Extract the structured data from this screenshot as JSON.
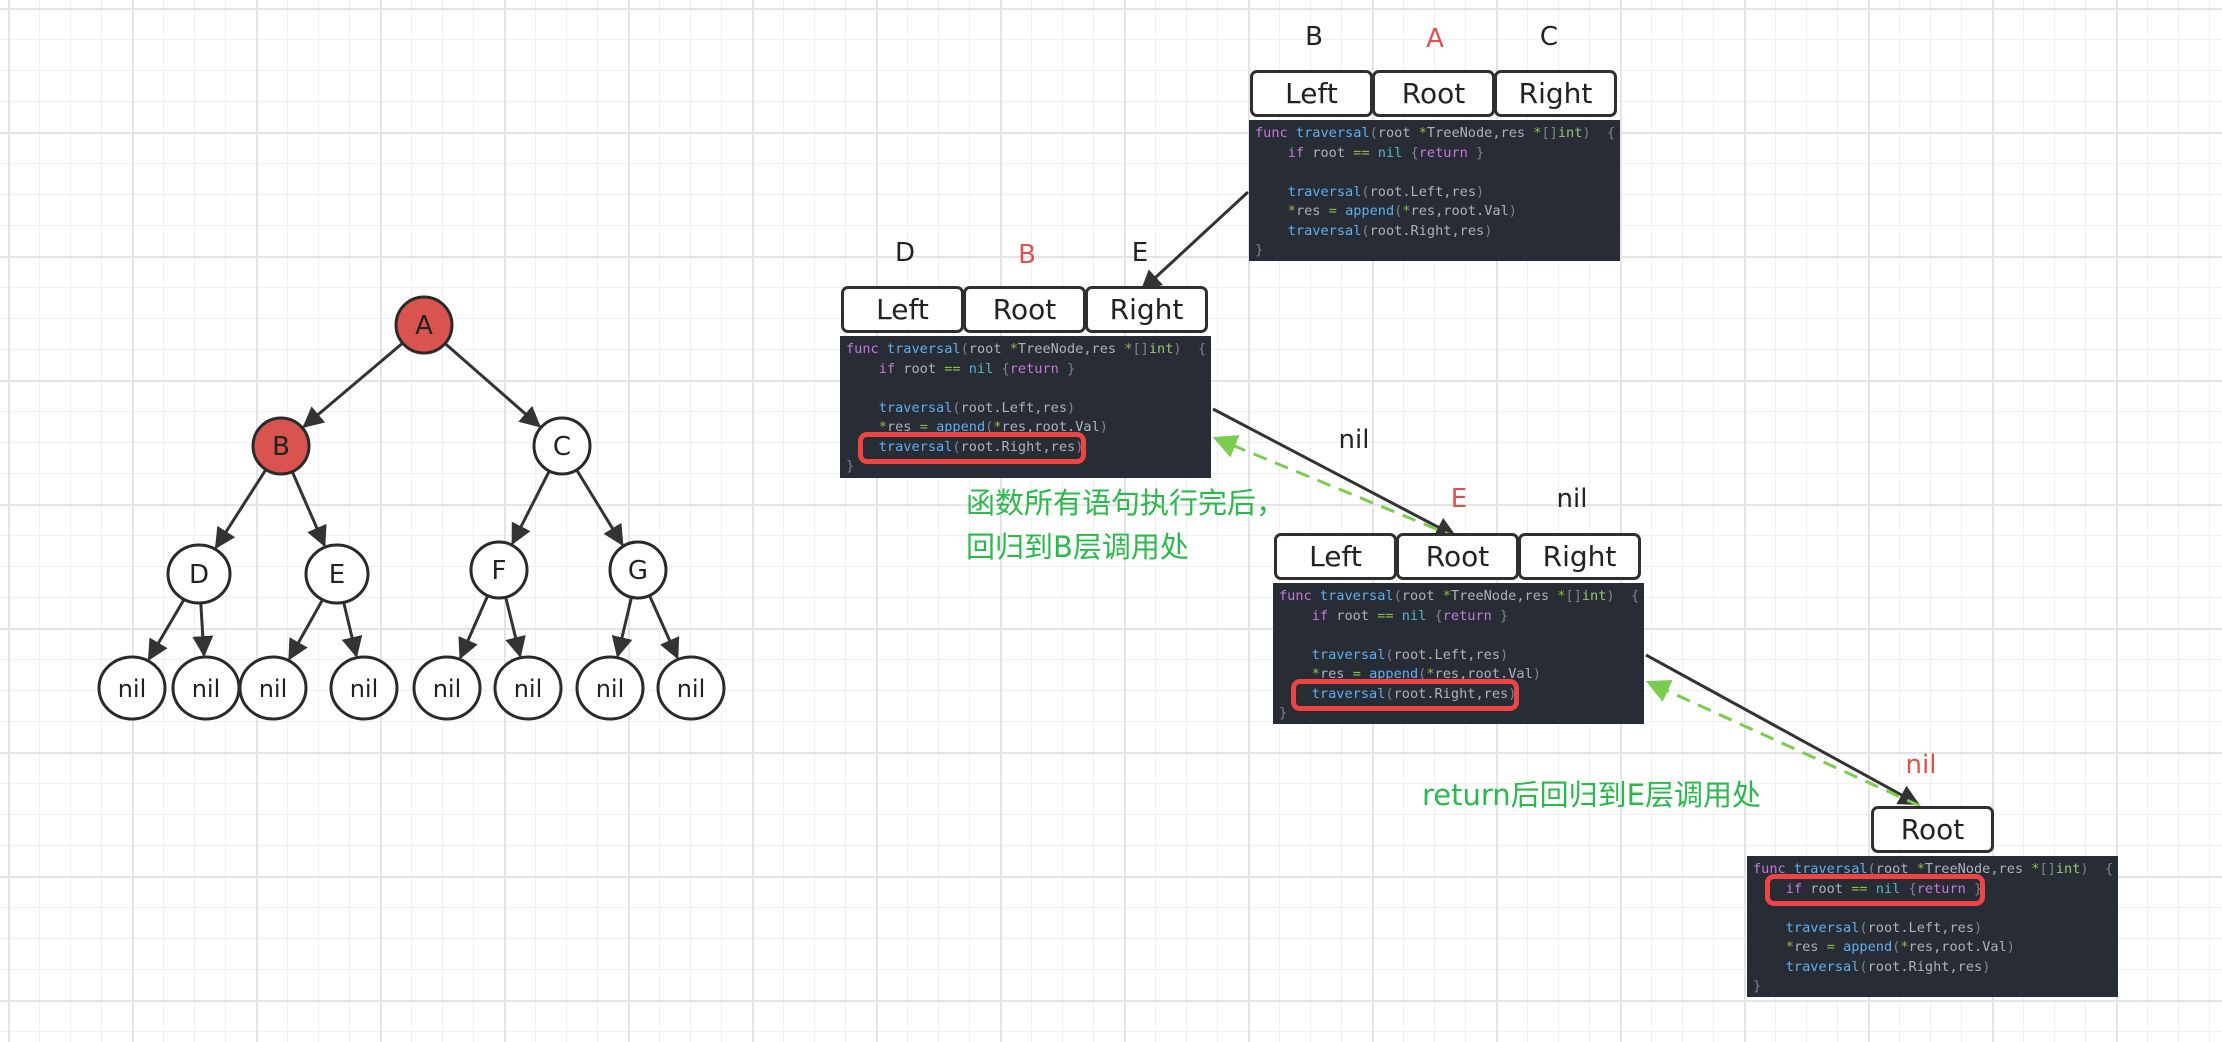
{
  "colors": {
    "highlight_node": "#d9534f",
    "normal_node": "#ffffff",
    "edge": "#333333",
    "return_arrow": "#7ccc52",
    "note_text": "#2db84d",
    "label_active": "#d9534f",
    "code_bg": "#282c34",
    "highlight_box": "#ef4444"
  },
  "tree": {
    "nodes": [
      {
        "id": "A",
        "label": "A",
        "highlighted": true
      },
      {
        "id": "B",
        "label": "B",
        "highlighted": true
      },
      {
        "id": "C",
        "label": "C",
        "highlighted": false
      },
      {
        "id": "D",
        "label": "D",
        "highlighted": false
      },
      {
        "id": "E",
        "label": "E",
        "highlighted": false
      },
      {
        "id": "F",
        "label": "F",
        "highlighted": false
      },
      {
        "id": "G",
        "label": "G",
        "highlighted": false
      },
      {
        "id": "n1",
        "label": "nil",
        "highlighted": false
      },
      {
        "id": "n2",
        "label": "nil",
        "highlighted": false
      },
      {
        "id": "n3",
        "label": "nil",
        "highlighted": false
      },
      {
        "id": "n4",
        "label": "nil",
        "highlighted": false
      },
      {
        "id": "n5",
        "label": "nil",
        "highlighted": false
      },
      {
        "id": "n6",
        "label": "nil",
        "highlighted": false
      },
      {
        "id": "n7",
        "label": "nil",
        "highlighted": false
      },
      {
        "id": "n8",
        "label": "nil",
        "highlighted": false
      }
    ],
    "edges": [
      [
        "A",
        "B"
      ],
      [
        "A",
        "C"
      ],
      [
        "B",
        "D"
      ],
      [
        "B",
        "E"
      ],
      [
        "C",
        "F"
      ],
      [
        "C",
        "G"
      ],
      [
        "D",
        "n1"
      ],
      [
        "D",
        "n2"
      ],
      [
        "E",
        "n3"
      ],
      [
        "E",
        "n4"
      ],
      [
        "F",
        "n5"
      ],
      [
        "F",
        "n6"
      ],
      [
        "G",
        "n7"
      ],
      [
        "G",
        "n8"
      ]
    ]
  },
  "frames": [
    {
      "id": "frame-A",
      "labels": {
        "left": "B",
        "root": "A",
        "right": "C"
      },
      "active_label": "root",
      "fields": [
        "Left",
        "Root",
        "Right"
      ],
      "highlight_line": null
    },
    {
      "id": "frame-B",
      "labels": {
        "left": "D",
        "root": "B",
        "right": "E"
      },
      "active_label": "root",
      "fields": [
        "Left",
        "Root",
        "Right"
      ],
      "highlight_line": 5
    },
    {
      "id": "frame-E",
      "labels": {
        "left": "nil",
        "root": "E",
        "right": "nil"
      },
      "active_label": "root",
      "fields": [
        "Left",
        "Root",
        "Right"
      ],
      "highlight_line": 5
    },
    {
      "id": "frame-nil",
      "labels": {
        "root": "nil"
      },
      "active_label": "root",
      "fields": [
        "Root"
      ],
      "highlight_line": 1
    }
  ],
  "code": {
    "lines": [
      [
        [
          "kw",
          "func "
        ],
        [
          "fn",
          "traversal"
        ],
        [
          "pn",
          "("
        ],
        [
          "",
          "root "
        ],
        [
          "op",
          "*"
        ],
        [
          "",
          "TreeNode,res "
        ],
        [
          "op",
          "*"
        ],
        [
          "pn",
          "[]"
        ],
        [
          "ty",
          "int"
        ],
        [
          "pn",
          ")  {"
        ]
      ],
      [
        [
          "",
          "    "
        ],
        [
          "kw",
          "if"
        ],
        [
          "",
          " root "
        ],
        [
          "op",
          "=="
        ],
        [
          "",
          " "
        ],
        [
          "nl",
          "nil"
        ],
        [
          "",
          " "
        ],
        [
          "pn",
          "{"
        ],
        [
          "kw",
          "return"
        ],
        [
          "pn",
          " }"
        ]
      ],
      [
        [
          "",
          ""
        ]
      ],
      [
        [
          "",
          "    "
        ],
        [
          "fn",
          "traversal"
        ],
        [
          "pn",
          "("
        ],
        [
          "",
          "root.Left,res"
        ],
        [
          "pn",
          ")"
        ]
      ],
      [
        [
          "",
          "    "
        ],
        [
          "op",
          "*"
        ],
        [
          "",
          "res "
        ],
        [
          "op",
          "="
        ],
        [
          "",
          " "
        ],
        [
          "fn",
          "append"
        ],
        [
          "pn",
          "("
        ],
        [
          "op",
          "*"
        ],
        [
          "",
          "res,root.Val"
        ],
        [
          "pn",
          ")"
        ]
      ],
      [
        [
          "",
          "    "
        ],
        [
          "fn",
          "traversal"
        ],
        [
          "pn",
          "("
        ],
        [
          "",
          "root.Right,res"
        ],
        [
          "pn",
          ")"
        ]
      ],
      [
        [
          "pn",
          "}"
        ]
      ]
    ]
  },
  "notes": {
    "return_to_b_line1": "函数所有语句执行完后，",
    "return_to_b_line2": "回归到B层调用处",
    "return_to_e": "return后回归到E层调用处"
  }
}
